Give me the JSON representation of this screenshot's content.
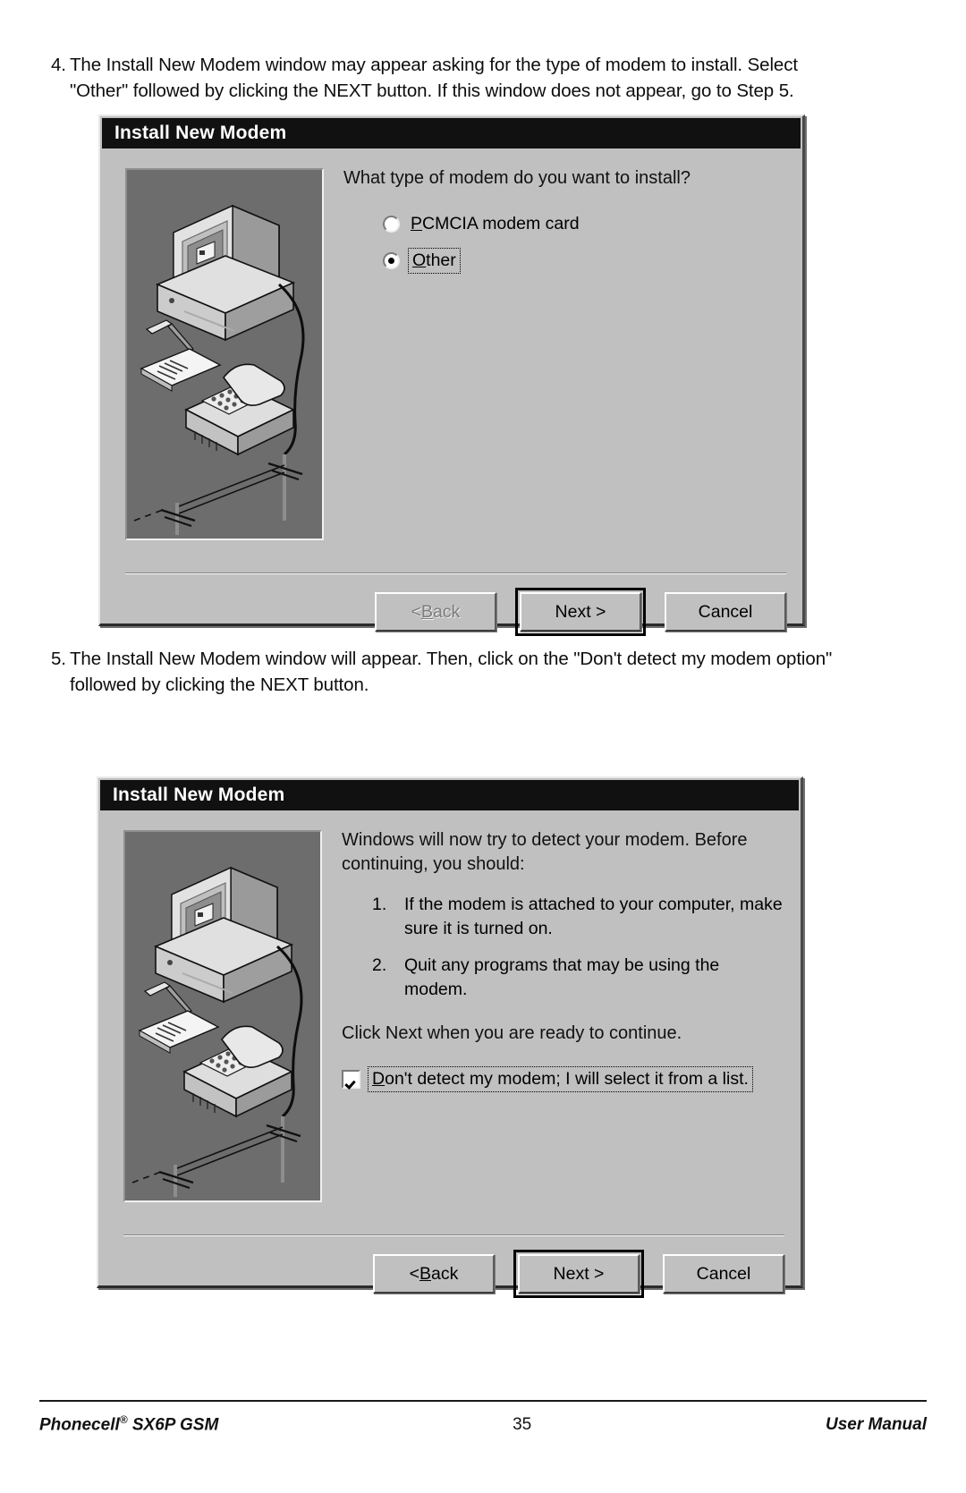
{
  "document": {
    "page_number": "35",
    "footer_left": "Phonecell",
    "footer_left_mark": "®",
    "footer_left_rest": " SX6P GSM",
    "footer_right": "User Manual"
  },
  "steps": [
    {
      "number": "4.",
      "text": "The Install New Modem window may appear asking for the type of modem to install. Select \"Other\" followed by clicking the NEXT button. If this window does not appear, go to Step 5."
    },
    {
      "number": "5.",
      "text": "The Install New Modem window will appear. Then, click on the \"Don't detect my modem option\" followed by clicking the NEXT button."
    }
  ],
  "dialog1": {
    "title": "Install New Modem",
    "prompt": "What type of modem do you want to install?",
    "options": [
      {
        "label_prefix": "",
        "label_accel": "P",
        "label_rest": "CMCIA modem card",
        "selected": false,
        "focused": false
      },
      {
        "label_prefix": "",
        "label_accel": "O",
        "label_rest": "ther",
        "selected": true,
        "focused": true
      }
    ],
    "buttons": [
      {
        "label_prefix": "< ",
        "label_accel": "B",
        "label_rest": "ack",
        "state": "disabled",
        "default": false
      },
      {
        "label_prefix": "Next >",
        "label_accel": "",
        "label_rest": "",
        "state": "normal",
        "default": true
      },
      {
        "label_prefix": "Cancel",
        "label_accel": "",
        "label_rest": "",
        "state": "normal",
        "default": false
      }
    ],
    "illustration": "isometric-computer-and-telephone-illustration"
  },
  "dialog2": {
    "title": "Install New Modem",
    "prompt": "Windows will now try to detect your modem.  Before continuing, you should:",
    "list": [
      {
        "marker": "1.",
        "text": "If the modem is attached to your computer, make sure it is turned on."
      },
      {
        "marker": "2.",
        "text": "Quit any programs that may be using the modem."
      }
    ],
    "closing": "Click Next when you are ready to continue.",
    "checkbox": {
      "checked": true,
      "focused": true,
      "label_accel": "D",
      "label_rest": "on't detect my modem; I will select it from a list."
    },
    "buttons": [
      {
        "label_prefix": "< ",
        "label_accel": "B",
        "label_rest": "ack",
        "state": "normal",
        "default": false
      },
      {
        "label_prefix": "Next >",
        "label_accel": "",
        "label_rest": "",
        "state": "normal",
        "default": true
      },
      {
        "label_prefix": "Cancel",
        "label_accel": "",
        "label_rest": "",
        "state": "normal",
        "default": false
      }
    ],
    "illustration": "isometric-computer-and-telephone-illustration"
  },
  "colors": {
    "dialog_face": "#c0c0c0",
    "titlebar": "#111111",
    "titlebar_text": "#ffffff",
    "illustration_bg": "#6d6d6d",
    "page_bg": "#ffffff"
  }
}
